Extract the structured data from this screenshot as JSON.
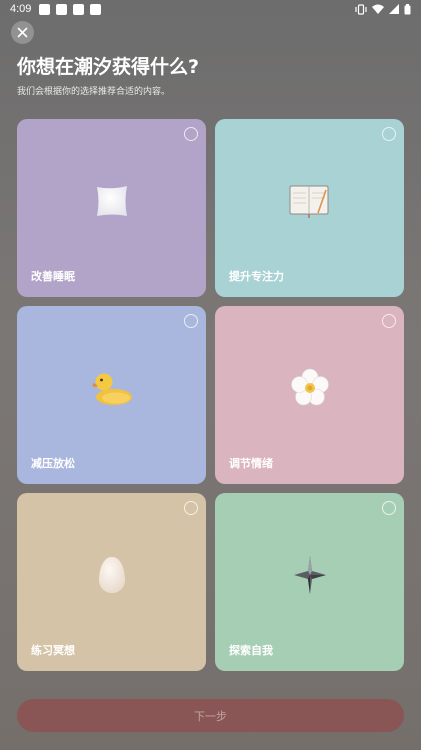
{
  "status_bar": {
    "time": "4:09",
    "notification_icons": [
      "app-icon",
      "app-icon",
      "download-icon",
      "app-icon"
    ],
    "right_icons": [
      "vibrate-icon",
      "wifi-icon",
      "signal-icon",
      "battery-icon"
    ]
  },
  "header": {
    "title": "你想在潮汐获得什么?",
    "subtitle": "我们会根据你的选择推荐合适的内容。"
  },
  "options": [
    {
      "label": "改善睡眠",
      "icon": "pillow-icon",
      "color": "#b2a4c9",
      "selected": false
    },
    {
      "label": "提升专注力",
      "icon": "notebook-icon",
      "color": "#a8d2d4",
      "selected": false
    },
    {
      "label": "减压放松",
      "icon": "rubber-duck-icon",
      "color": "#a9b6dd",
      "selected": false
    },
    {
      "label": "调节情绪",
      "icon": "flower-icon",
      "color": "#dab4bf",
      "selected": false
    },
    {
      "label": "练习冥想",
      "icon": "egg-icon",
      "color": "#d4c3a6",
      "selected": false
    },
    {
      "label": "探索自我",
      "icon": "spinning-top-icon",
      "color": "#a6ceb5",
      "selected": false
    }
  ],
  "footer": {
    "next_label": "下一步",
    "next_enabled": false
  }
}
